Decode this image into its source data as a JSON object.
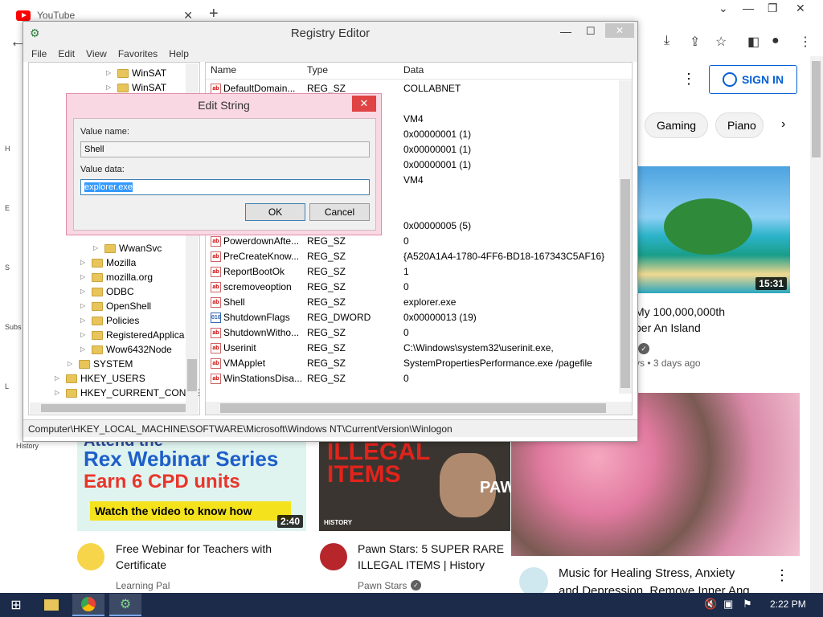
{
  "browser": {
    "tab_title": "YouTube",
    "tab_close": "✕",
    "new_tab": "+",
    "back": "←",
    "window_min": "⌄",
    "window_min2": "—",
    "window_restore": "❐",
    "window_close": "✕"
  },
  "youtube": {
    "sign_in": "SIGN IN",
    "chips": [
      "Gaming",
      "Piano"
    ],
    "sidebar_labels": [
      "H",
      "E",
      "S",
      "Subs",
      "L",
      "History"
    ],
    "videos": [
      {
        "title_line1": "My 100,000,000th",
        "title_line2": "ber An Island",
        "meta": "vs • 3 days ago",
        "duration": "15:31"
      },
      {
        "title_line1": "Free Webinar for Teachers with",
        "title_line2": "Certificate",
        "channel": "Learning Pal",
        "duration": "2:40",
        "thumb_l1": "Rex Webinar Series",
        "thumb_l2": "Earn 6 CPD units",
        "thumb_l3": "Watch the video to know how",
        "thumb_top": "Attend the"
      },
      {
        "title_line1": "Pawn Stars: 5 SUPER RARE",
        "title_line2": "ILLEGAL ITEMS | History",
        "channel": "Pawn Stars",
        "thumb_l1": "ILLEGAL",
        "thumb_l2": "ITEMS",
        "thumb_tag": "PAWN",
        "thumb_brand": "HISTORY"
      },
      {
        "title_line1": "Music for Healing Stress, Anxiety",
        "title_line2": "and Depression, Remove Inner Ang"
      }
    ]
  },
  "regedit": {
    "title": "Registry Editor",
    "menu": [
      "File",
      "Edit",
      "View",
      "Favorites",
      "Help"
    ],
    "tree": [
      {
        "label": "WinSAT",
        "indent": 7
      },
      {
        "label": "WinSAT",
        "indent": 7
      },
      {
        "label": "WwanSvc",
        "indent": 6
      },
      {
        "label": "Mozilla",
        "indent": 5
      },
      {
        "label": "mozilla.org",
        "indent": 5
      },
      {
        "label": "ODBC",
        "indent": 5
      },
      {
        "label": "OpenShell",
        "indent": 5
      },
      {
        "label": "Policies",
        "indent": 5
      },
      {
        "label": "RegisteredApplica",
        "indent": 5
      },
      {
        "label": "Wow6432Node",
        "indent": 5
      },
      {
        "label": "SYSTEM",
        "indent": 4
      },
      {
        "label": "HKEY_USERS",
        "indent": 3
      },
      {
        "label": "HKEY_CURRENT_CONFIG",
        "indent": 3
      }
    ],
    "columns": [
      "Name",
      "Type",
      "Data"
    ],
    "rows": [
      {
        "name": "DefaultDomain...",
        "type": "REG_SZ",
        "data": "COLLABNET",
        "kind": "sz"
      },
      {
        "name": "",
        "type": "",
        "data": "VM4",
        "kind": "sz"
      },
      {
        "name": "",
        "type": "",
        "data": "0x00000001 (1)",
        "kind": "bin"
      },
      {
        "name": "",
        "type": "",
        "data": "0x00000001 (1)",
        "kind": "bin"
      },
      {
        "name": "",
        "type": "",
        "data": "0x00000001 (1)",
        "kind": "bin"
      },
      {
        "name": "",
        "type": "",
        "data": "VM4",
        "kind": "sz"
      },
      {
        "name": "",
        "type": "",
        "data": "0x00000005 (5)",
        "kind": "bin"
      },
      {
        "name": "PowerdownAfte...",
        "type": "REG_SZ",
        "data": "0",
        "kind": "sz"
      },
      {
        "name": "PreCreateKnow...",
        "type": "REG_SZ",
        "data": "{A520A1A4-1780-4FF6-BD18-167343C5AF16}",
        "kind": "sz"
      },
      {
        "name": "ReportBootOk",
        "type": "REG_SZ",
        "data": "1",
        "kind": "sz"
      },
      {
        "name": "scremoveoption",
        "type": "REG_SZ",
        "data": "0",
        "kind": "sz"
      },
      {
        "name": "Shell",
        "type": "REG_SZ",
        "data": "explorer.exe",
        "kind": "sz"
      },
      {
        "name": "ShutdownFlags",
        "type": "REG_DWORD",
        "data": "0x00000013 (19)",
        "kind": "bin"
      },
      {
        "name": "ShutdownWitho...",
        "type": "REG_SZ",
        "data": "0",
        "kind": "sz"
      },
      {
        "name": "Userinit",
        "type": "REG_SZ",
        "data": "C:\\Windows\\system32\\userinit.exe,",
        "kind": "sz"
      },
      {
        "name": "VMApplet",
        "type": "REG_SZ",
        "data": "SystemPropertiesPerformance.exe /pagefile",
        "kind": "sz"
      },
      {
        "name": "WinStationsDisa...",
        "type": "REG_SZ",
        "data": "0",
        "kind": "sz"
      }
    ],
    "status": "Computer\\HKEY_LOCAL_MACHINE\\SOFTWARE\\Microsoft\\Windows NT\\CurrentVersion\\Winlogon"
  },
  "dialog": {
    "title": "Edit String",
    "close": "✕",
    "value_name_label": "Value name:",
    "value_name": "Shell",
    "value_data_label": "Value data:",
    "value_data": "explorer.exe",
    "ok": "OK",
    "cancel": "Cancel"
  },
  "taskbar": {
    "clock": "2:22 PM"
  },
  "colors": {
    "dialog_border": "#e28aab",
    "selection": "#3399ff",
    "taskbar": "#1c2b4a",
    "yt_blue": "#065fd4"
  }
}
